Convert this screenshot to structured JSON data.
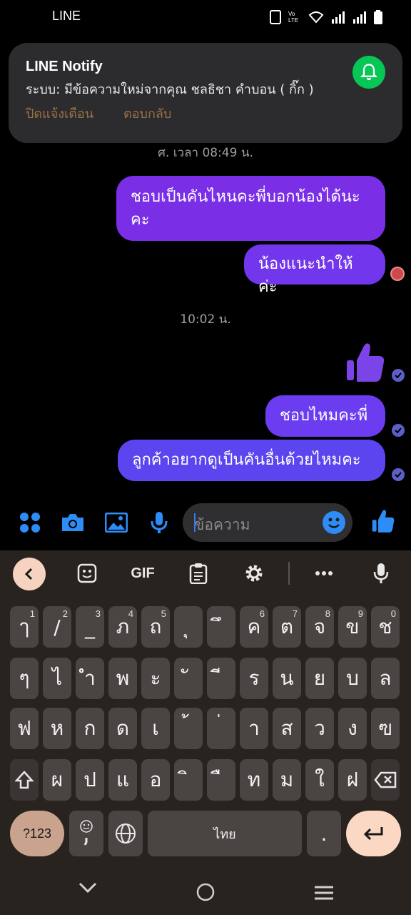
{
  "status_bar": {
    "app_name": "LINE"
  },
  "notification": {
    "title": "LINE Notify",
    "body": "ระบบ:  มีข้อความใหม่จากคุณ ชลธิชา คำบอน  ( กิ๊ก )",
    "actions": [
      "ปิดแจ้งเตือน",
      "ตอบกลับ"
    ],
    "icon": "bell-icon",
    "accent": "#06c755"
  },
  "chat": {
    "date_label": "ศ. เวลา 08:49 น.",
    "messages_1": [
      "ชอบเป็นคันไหนคะพี่บอกน้องได้นะคะ",
      "น้องแนะนำให้ค่ะ"
    ],
    "time_label": "10:02 น.",
    "sticker": "thumbs-up-icon",
    "messages_2": [
      "ชอบไหมคะพี่",
      "ลูกค้าอยากดูเป็นคันอื่นด้วยไหมคะ"
    ],
    "bubble_colors": [
      "#7a2ee6",
      "#6b3cf0",
      "#5b45ee"
    ]
  },
  "composer": {
    "placeholder": "ข้อความ"
  },
  "keyboard": {
    "toolbar": {
      "gif": "GIF"
    },
    "row1": [
      {
        "k": "ๅ",
        "s": "1"
      },
      {
        "k": "/",
        "s": "2"
      },
      {
        "k": "_",
        "s": "3"
      },
      {
        "k": "ภ",
        "s": "4"
      },
      {
        "k": "ถ",
        "s": "5"
      },
      {
        "k": "ุ",
        "s": ""
      },
      {
        "k": "ึ",
        "s": ""
      },
      {
        "k": "ค",
        "s": "6"
      },
      {
        "k": "ต",
        "s": "7"
      },
      {
        "k": "จ",
        "s": "8"
      },
      {
        "k": "ข",
        "s": "9"
      },
      {
        "k": "ช",
        "s": "0"
      }
    ],
    "row2": [
      "ๆ",
      "ไ",
      "ำ",
      "พ",
      "ะ",
      "ั",
      "ี",
      "ร",
      "น",
      "ย",
      "บ",
      "ล"
    ],
    "row3": [
      "ฟ",
      "ห",
      "ก",
      "ด",
      "เ",
      "้",
      "่",
      "า",
      "ส",
      "ว",
      "ง",
      "ฃ"
    ],
    "row4": [
      "ผ",
      "ป",
      "แ",
      "อ",
      "ิ",
      "ื",
      "ท",
      "ม",
      "ใ",
      "ฝ"
    ],
    "symbols_label": "?123",
    "space_label": "ไทย",
    "period_label": "."
  }
}
